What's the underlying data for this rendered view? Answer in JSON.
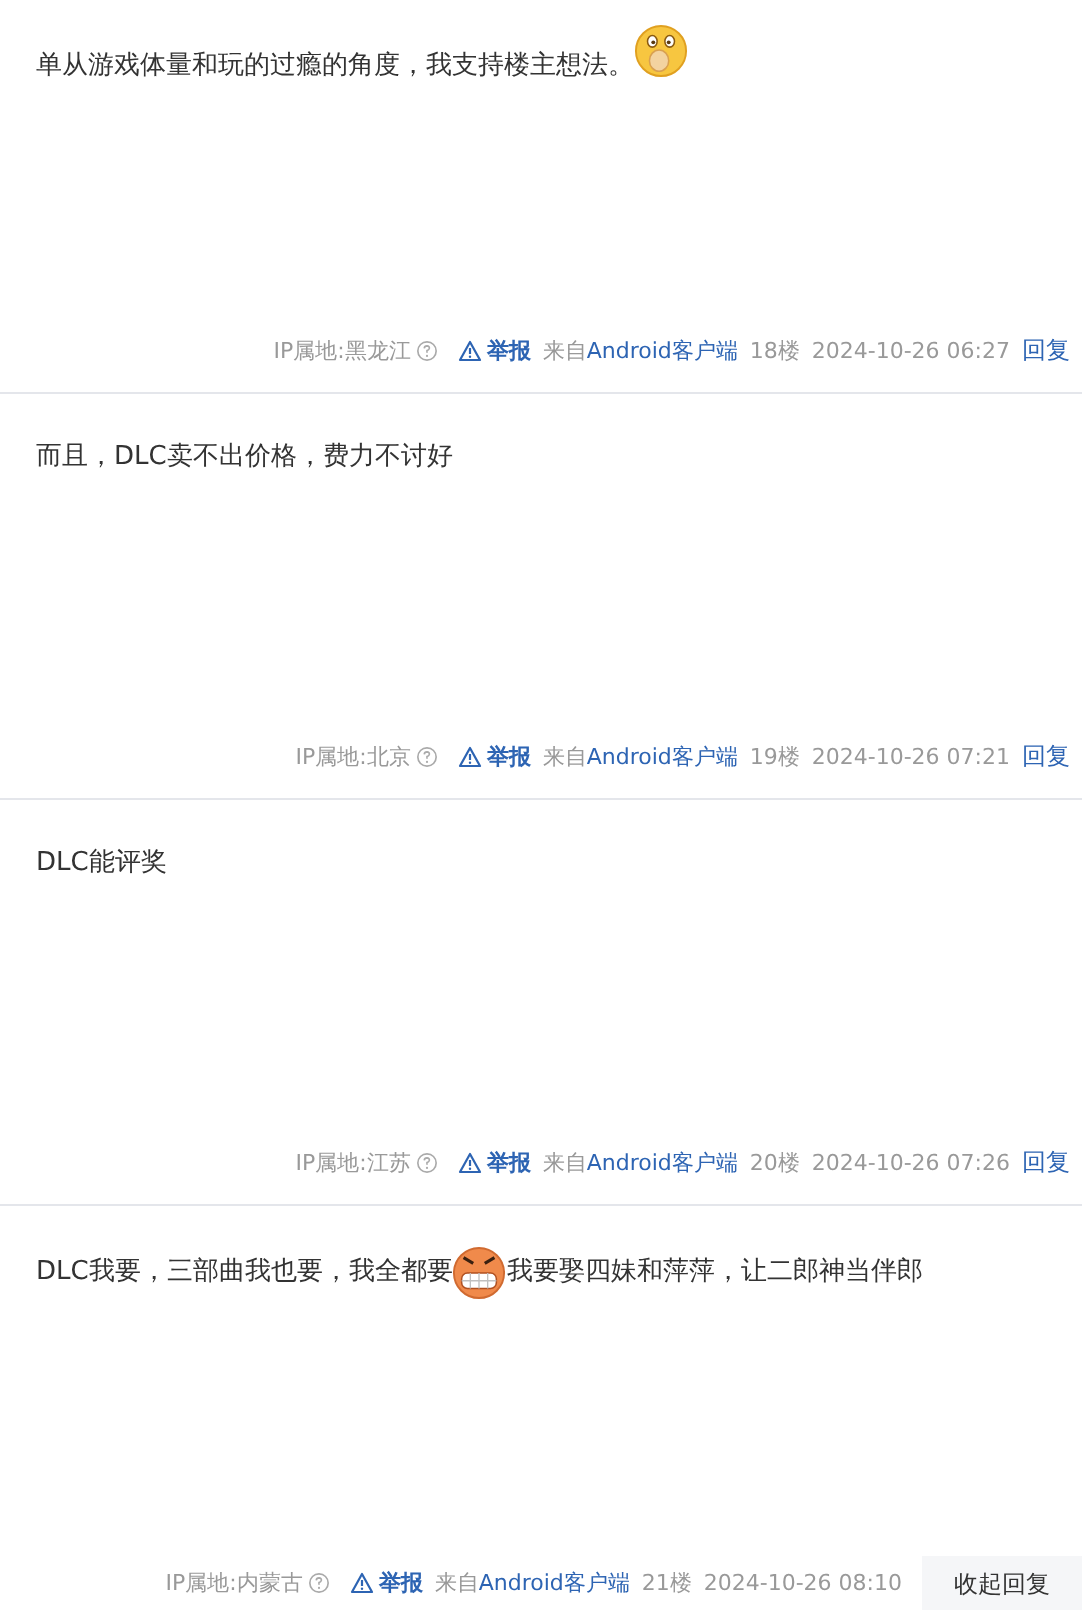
{
  "posts": [
    {
      "content": [
        {
          "kind": "text",
          "text": "单从游戏体量和玩的过瘾的角度，我支持楼主想法。"
        },
        {
          "kind": "yawn"
        }
      ],
      "footer": {
        "ip": "IP属地:黑龙江",
        "report": "举报",
        "source_prefix": "来自",
        "source": "Android客户端",
        "floor": "18楼",
        "time": "2024-10-26 06:27",
        "reply": "回复",
        "reply_expanded": false
      }
    },
    {
      "content": [
        {
          "kind": "text",
          "text": "而且，DLC卖不出价格，费力不讨好"
        }
      ],
      "footer": {
        "ip": "IP属地:北京",
        "report": "举报",
        "source_prefix": "来自",
        "source": "Android客户端",
        "floor": "19楼",
        "time": "2024-10-26 07:21",
        "reply": "回复",
        "reply_expanded": false
      }
    },
    {
      "content": [
        {
          "kind": "text",
          "text": "DLC能评奖"
        }
      ],
      "footer": {
        "ip": "IP属地:江苏",
        "report": "举报",
        "source_prefix": "来自",
        "source": "Android客户端",
        "floor": "20楼",
        "time": "2024-10-26 07:26",
        "reply": "回复",
        "reply_expanded": false
      }
    },
    {
      "content": [
        {
          "kind": "text",
          "text": "DLC我要，三部曲我也要，我全都要"
        },
        {
          "kind": "grin"
        },
        {
          "kind": "text",
          "text": "我要娶四妹和萍萍，让二郎神当伴郎"
        }
      ],
      "footer": {
        "ip": "IP属地:内蒙古",
        "report": "举报",
        "source_prefix": "来自",
        "source": "Android客户端",
        "floor": "21楼",
        "time": "2024-10-26 08:10",
        "reply": "收起回复",
        "reply_expanded": true
      }
    }
  ]
}
